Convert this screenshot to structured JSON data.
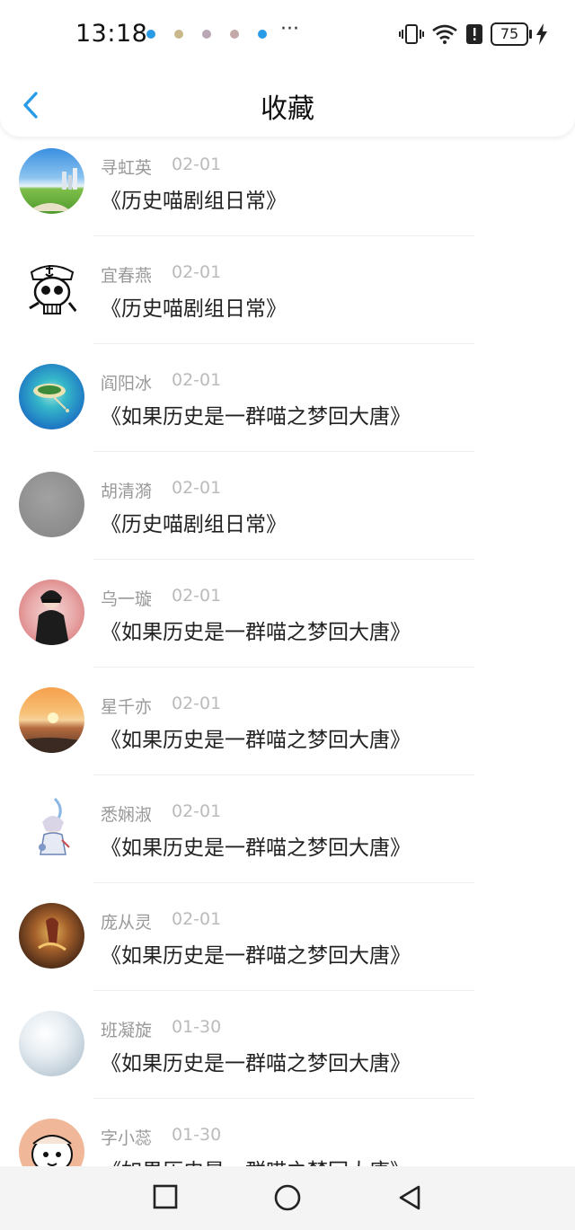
{
  "status_bar": {
    "time": "13:18",
    "overflow": "···",
    "battery": "75",
    "icons": [
      "vibrate-icon",
      "wifi-icon",
      "alert-icon",
      "charging-icon"
    ]
  },
  "header": {
    "title": "收藏",
    "back_icon": "chevron-left-icon"
  },
  "items": [
    {
      "name": "寻虹英",
      "date": "02-01",
      "book": "《历史喵剧组日常》",
      "avatar": "landscape"
    },
    {
      "name": "宜春燕",
      "date": "02-01",
      "book": "《历史喵剧组日常》",
      "avatar": "skull"
    },
    {
      "name": "阎阳冰",
      "date": "02-01",
      "book": "《如果历史是一群喵之梦回大唐》",
      "avatar": "island"
    },
    {
      "name": "胡清漪",
      "date": "02-01",
      "book": "《历史喵剧组日常》",
      "avatar": "grey"
    },
    {
      "name": "乌一璇",
      "date": "02-01",
      "book": "《如果历史是一群喵之梦回大唐》",
      "avatar": "person"
    },
    {
      "name": "星千亦",
      "date": "02-01",
      "book": "《如果历史是一群喵之梦回大唐》",
      "avatar": "sunset"
    },
    {
      "name": "悉娴淑",
      "date": "02-01",
      "book": "《如果历史是一群喵之梦回大唐》",
      "avatar": "anime"
    },
    {
      "name": "庞从灵",
      "date": "02-01",
      "book": "《如果历史是一群喵之梦回大唐》",
      "avatar": "fire"
    },
    {
      "name": "班凝旋",
      "date": "01-30",
      "book": "《如果历史是一群喵之梦回大唐》",
      "avatar": "sky"
    },
    {
      "name": "字小蕊",
      "date": "01-30",
      "book": "《如果历史是一群喵之梦回大唐》",
      "avatar": "cartoon"
    }
  ],
  "nav_bar": {
    "buttons": [
      "recent-apps-icon",
      "home-icon",
      "back-triangle-icon"
    ]
  },
  "colors": {
    "accent": "#2a9be6",
    "name_text": "#999999",
    "date_text": "#bbbbbb"
  }
}
